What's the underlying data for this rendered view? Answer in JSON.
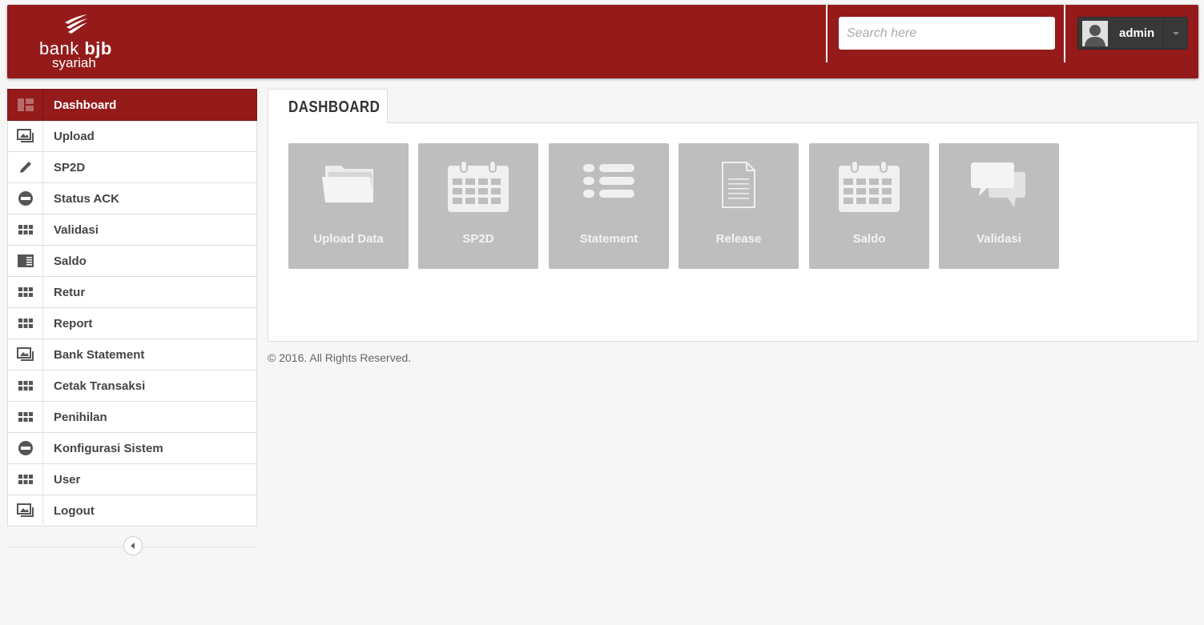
{
  "header": {
    "logo_bank": "bank",
    "logo_bjb": "bjb",
    "logo_syariah": "syariah",
    "search_placeholder": "Search here",
    "username": "admin",
    "brand_color": "#951b1b"
  },
  "sidebar": {
    "items": [
      {
        "label": "Dashboard",
        "icon": "dashboard-icon"
      },
      {
        "label": "Upload",
        "icon": "picture-icon"
      },
      {
        "label": "SP2D",
        "icon": "pencil-icon"
      },
      {
        "label": "Status ACK",
        "icon": "minus-circle-icon"
      },
      {
        "label": "Validasi",
        "icon": "grid-icon"
      },
      {
        "label": "Saldo",
        "icon": "newspaper-icon"
      },
      {
        "label": "Retur",
        "icon": "grid-icon"
      },
      {
        "label": "Report",
        "icon": "grid-icon"
      },
      {
        "label": "Bank Statement",
        "icon": "picture-icon"
      },
      {
        "label": "Cetak Transaksi",
        "icon": "grid-icon"
      },
      {
        "label": "Penihilan",
        "icon": "grid-icon"
      },
      {
        "label": "Konfigurasi Sistem",
        "icon": "minus-circle-icon"
      },
      {
        "label": "User",
        "icon": "grid-icon"
      },
      {
        "label": "Logout",
        "icon": "picture-icon"
      }
    ]
  },
  "main": {
    "tab_label": "DASHBOARD",
    "tiles": [
      {
        "label": "Upload Data",
        "icon": "folder-icon"
      },
      {
        "label": "SP2D",
        "icon": "calendar-icon"
      },
      {
        "label": "Statement",
        "icon": "list-icon"
      },
      {
        "label": "Release",
        "icon": "document-icon"
      },
      {
        "label": "Saldo",
        "icon": "calendar-icon"
      },
      {
        "label": "Validasi",
        "icon": "chat-icon"
      }
    ]
  },
  "footer": {
    "text": "© 2016. All Rights Reserved."
  }
}
